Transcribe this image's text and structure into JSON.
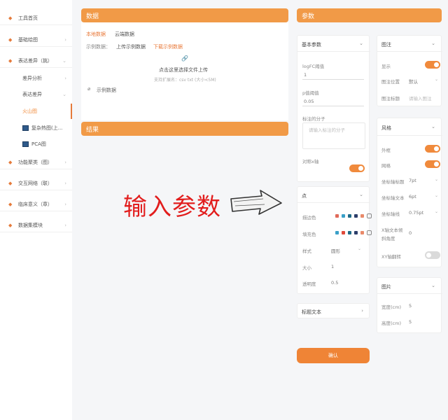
{
  "sidebar": {
    "items": [
      {
        "label": "工具首页"
      },
      {
        "label": "基础绘图"
      },
      {
        "label": "表达差异（挑）"
      }
    ],
    "sub_items": [
      {
        "label": "差异分析"
      },
      {
        "label": "表达差异"
      },
      {
        "label": "火山图"
      },
      {
        "label": "复杂热图(上..."
      },
      {
        "label": "PCA图"
      }
    ],
    "bottom_items": [
      {
        "label": "功能聚类（图）"
      },
      {
        "label": "交互网络（联）"
      },
      {
        "label": "临床意义（章）"
      },
      {
        "label": "数据集模块"
      }
    ]
  },
  "data_panel": {
    "title": "数据",
    "tabs": [
      "本地数据",
      "云端数据"
    ],
    "example_label": "示例数据：",
    "upload_example": "上传示例数据",
    "download_example": "下载示例数据",
    "upload_text": "点击这里选择文件上传",
    "upload_hint": "支持扩展名：csv txt (大小<5M)",
    "example_file": "示例数据"
  },
  "result_panel": {
    "title": "结果"
  },
  "overlay": {
    "text": "输入参数"
  },
  "params": {
    "title": "参数",
    "basic": {
      "title": "基本参数",
      "logfc_label": "logFC阈值",
      "logfc_value": "1",
      "p_label": "p值阈值",
      "p_value": "0.05",
      "mark_label": "标注的分子",
      "mark_placeholder": "请输入标注的分子",
      "symmetric_label": "对称x轴"
    },
    "point": {
      "title": "点",
      "stroke_label": "描边色",
      "fill_label": "填充色",
      "style_label": "样式",
      "style_value": "圆形",
      "size_label": "大小",
      "size_value": "1",
      "opacity_label": "透明度",
      "opacity_value": "0.5"
    },
    "title_text": {
      "title": "标题文本"
    },
    "legend": {
      "title": "图注",
      "show_label": "显示",
      "pos_label": "图注位置",
      "pos_value": "默认",
      "title_label": "图注标题",
      "title_placeholder": "请输入图注"
    },
    "style": {
      "title": "风格",
      "frame_label": "外框",
      "grid_label": "网格",
      "tick_label": "坐标轴标题",
      "tick_value": "7pt",
      "axis_text_label": "坐标轴文本",
      "axis_text_value": "6pt",
      "axis_line_label": "坐标轴线",
      "axis_line_value": "0.75pt",
      "xangle_label": "X轴文本倾斜角度",
      "xangle_value": "0",
      "xy_label": "XY轴翻转"
    },
    "image": {
      "title": "图片",
      "width_label": "宽度(cm)",
      "width_value": "5",
      "height_label": "高度(cm)",
      "height_value": "5"
    },
    "confirm_label": "确认"
  },
  "colors": {
    "accent": "#f19a47",
    "stroke_swatches": [
      "#e06a5a",
      "#3aa0c8",
      "#1f6b88",
      "#2c3e6b",
      "#e98a6a"
    ],
    "fill_swatches": [
      "#3aa0c8",
      "#e04a3a",
      "#1f6b88",
      "#2c3e6b",
      "#e98a6a"
    ]
  }
}
